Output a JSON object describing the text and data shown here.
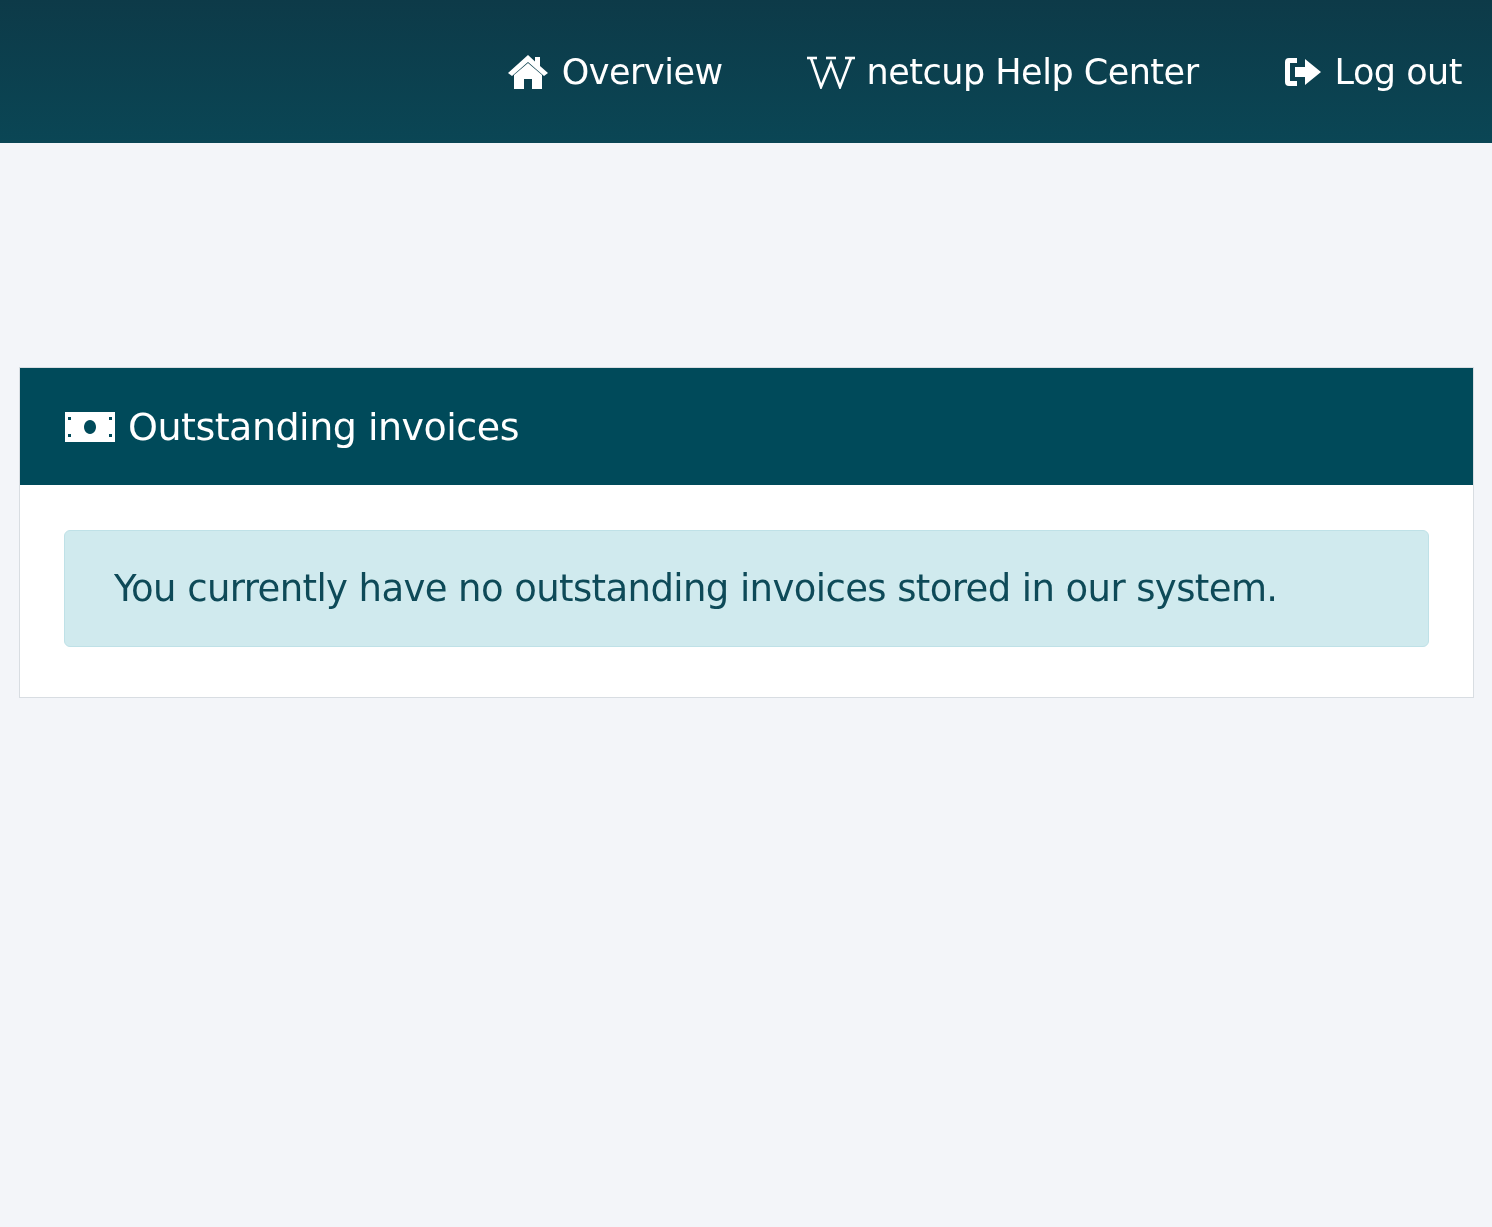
{
  "nav": [
    {
      "kind": "home",
      "label": "Overview"
    },
    {
      "kind": "wiki",
      "label": "netcup Help Center"
    },
    {
      "kind": "logout",
      "label": "Log out"
    }
  ],
  "card": {
    "title": "Outstanding invoices",
    "alert": "You currently have no outstanding invoices stored in our system."
  }
}
